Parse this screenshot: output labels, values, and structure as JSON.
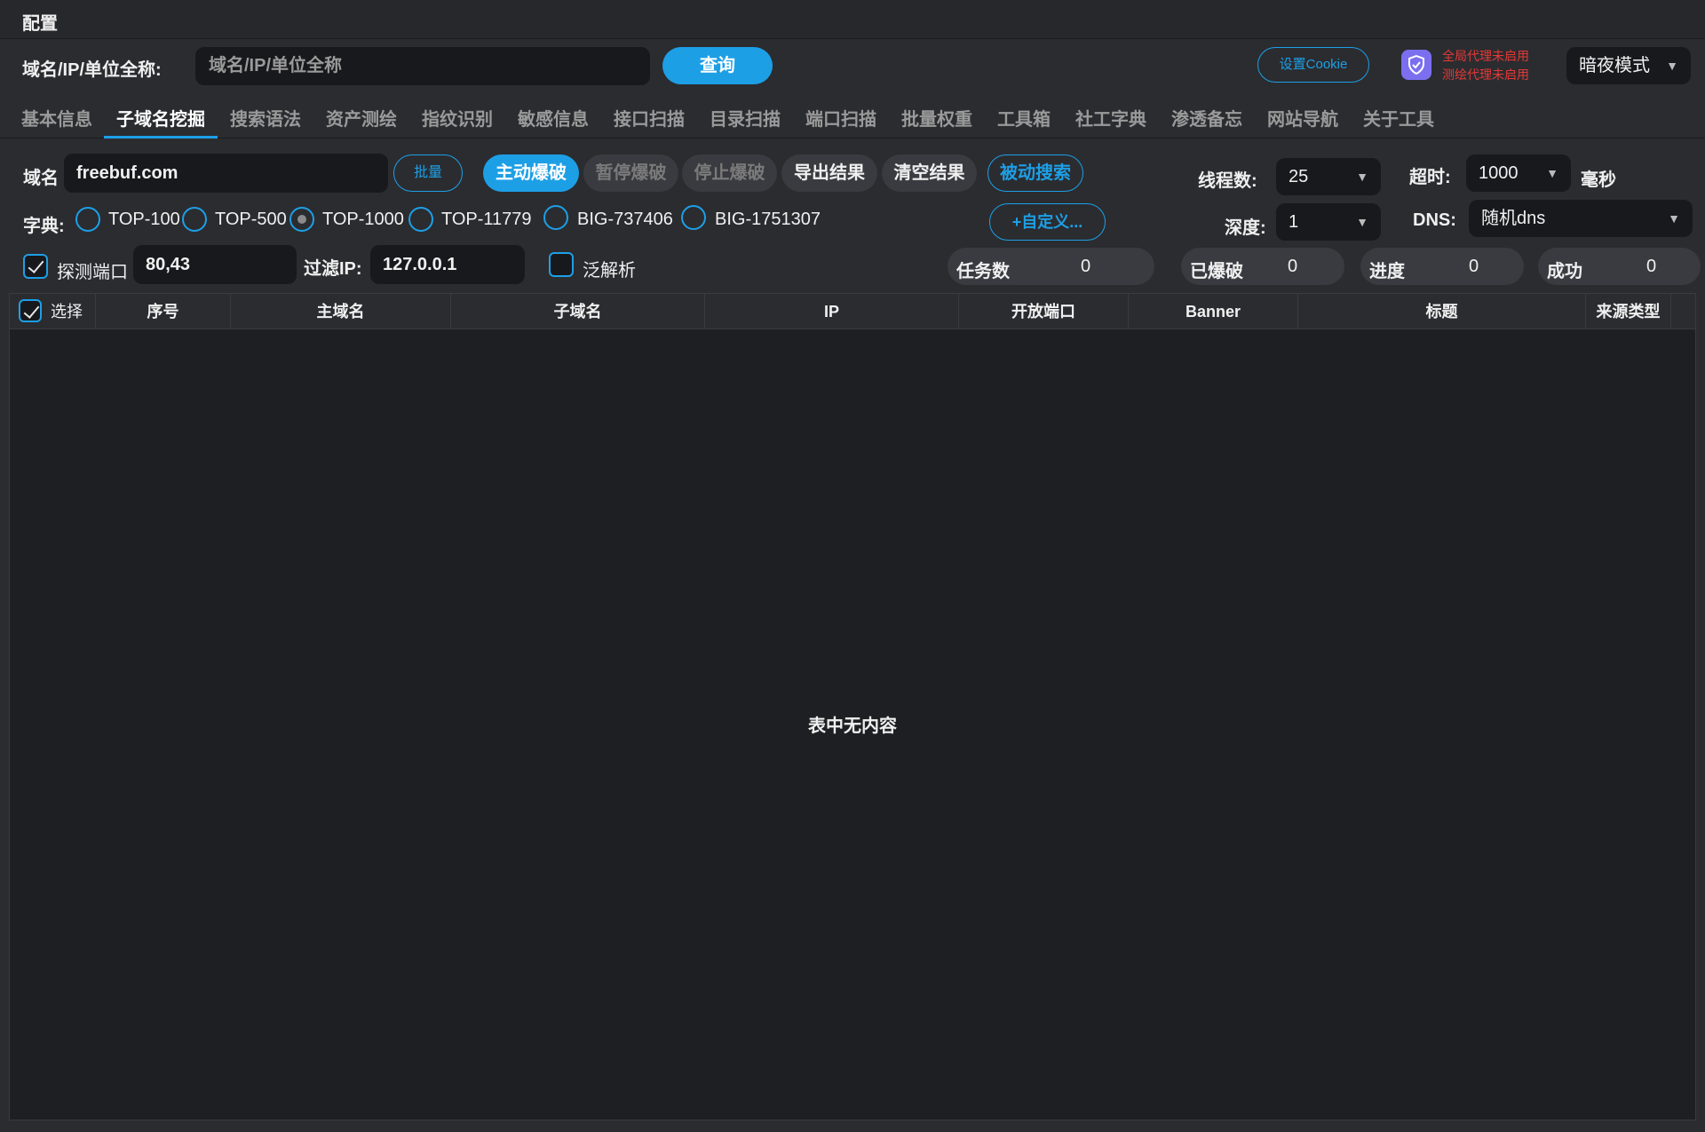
{
  "menu": {
    "config": "配置"
  },
  "query": {
    "label": "域名/IP/单位全称:",
    "placeholder": "域名/IP/单位全称",
    "button": "查询"
  },
  "header": {
    "cookie_button": "设置Cookie",
    "proxy_global": "全局代理未启用",
    "proxy_test": "测绘代理未启用",
    "proxy_color": "#e53935",
    "mode": "暗夜模式",
    "accent": "#1d9fe6"
  },
  "tabs": [
    {
      "label": "基本信息"
    },
    {
      "label": "子域名挖掘",
      "active": true
    },
    {
      "label": "搜索语法"
    },
    {
      "label": "资产测绘"
    },
    {
      "label": "指纹识别"
    },
    {
      "label": "敏感信息"
    },
    {
      "label": "接口扫描"
    },
    {
      "label": "目录扫描"
    },
    {
      "label": "端口扫描"
    },
    {
      "label": "批量权重"
    },
    {
      "label": "工具箱"
    },
    {
      "label": "社工字典"
    },
    {
      "label": "渗透备忘"
    },
    {
      "label": "网站导航"
    },
    {
      "label": "关于工具"
    }
  ],
  "form": {
    "domain_label": "域名",
    "domain_value": "freebuf.com",
    "batch_button": "批量",
    "active_brute": "主动爆破",
    "pause_brute": "暂停爆破",
    "stop_brute": "停止爆破",
    "export_results": "导出结果",
    "clear_results": "清空结果",
    "passive_search": "被动搜索",
    "dict_label": "字典:",
    "dicts": [
      "TOP-100",
      "TOP-500",
      "TOP-1000",
      "TOP-11779",
      "BIG-737406",
      "BIG-1751307"
    ],
    "dict_selected": "TOP-1000",
    "custom_button": "+自定义...",
    "threads_label": "线程数:",
    "threads_value": "25",
    "timeout_label": "超时:",
    "timeout_value": "1000",
    "timeout_unit": "毫秒",
    "depth_label": "深度:",
    "depth_value": "1",
    "dns_label": "DNS:",
    "dns_value": "随机dns",
    "probe_port_label": "探测端口",
    "probe_port_checked": true,
    "probe_port_value": "80,43",
    "filter_ip_label": "过滤IP:",
    "filter_ip_value": "127.0.0.1",
    "wildcard_label": "泛解析",
    "wildcard_checked": false
  },
  "stats": {
    "tasks_label": "任务数",
    "tasks_value": "0",
    "done_label": "已爆破",
    "done_value": "0",
    "progress_label": "进度",
    "progress_value": "0",
    "success_label": "成功",
    "success_value": "0"
  },
  "table": {
    "columns": [
      "选择",
      "序号",
      "主域名",
      "子域名",
      "IP",
      "开放端口",
      "Banner",
      "标题",
      "来源类型"
    ],
    "empty_text": "表中无内容"
  }
}
